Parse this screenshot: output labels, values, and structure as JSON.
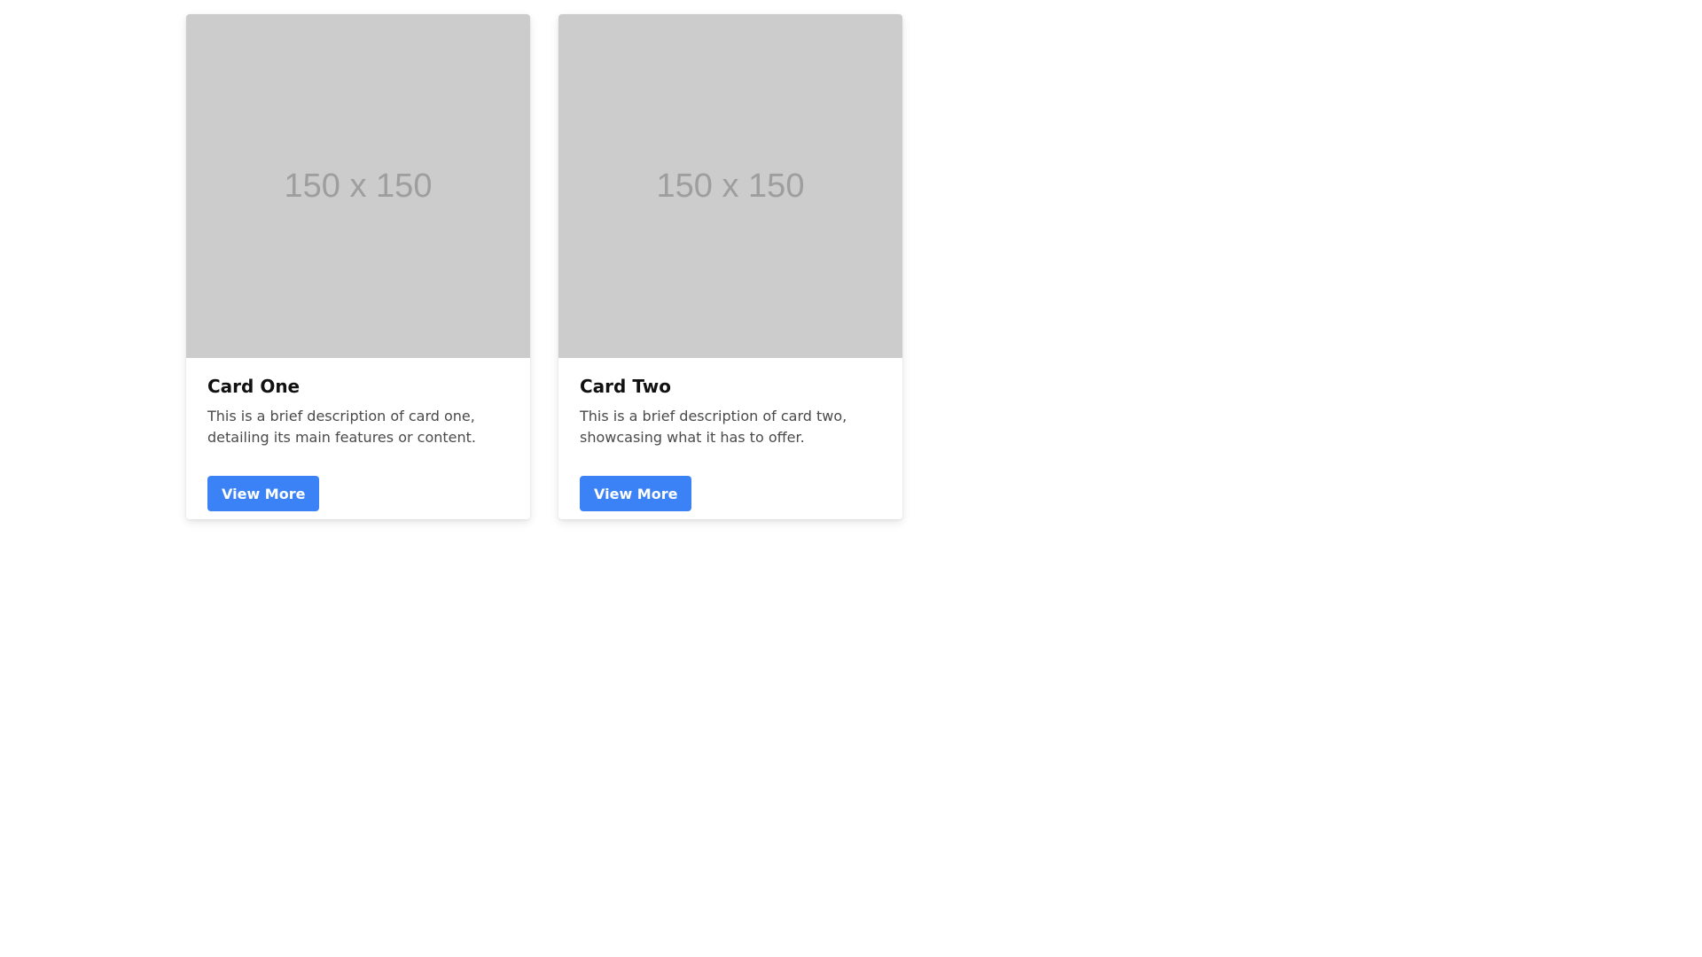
{
  "cards": [
    {
      "image_text": "150 x 150",
      "title": "Card One",
      "description": "This is a brief description of card one, detailing its main features or content.",
      "button_label": "View More"
    },
    {
      "image_text": "150 x 150",
      "title": "Card Two",
      "description": "This is a brief description of card two, showcasing what it has to offer.",
      "button_label": "View More"
    }
  ],
  "colors": {
    "button": "#3b82f6",
    "placeholder_bg": "#cccccc",
    "placeholder_text": "#9e9e9e"
  }
}
